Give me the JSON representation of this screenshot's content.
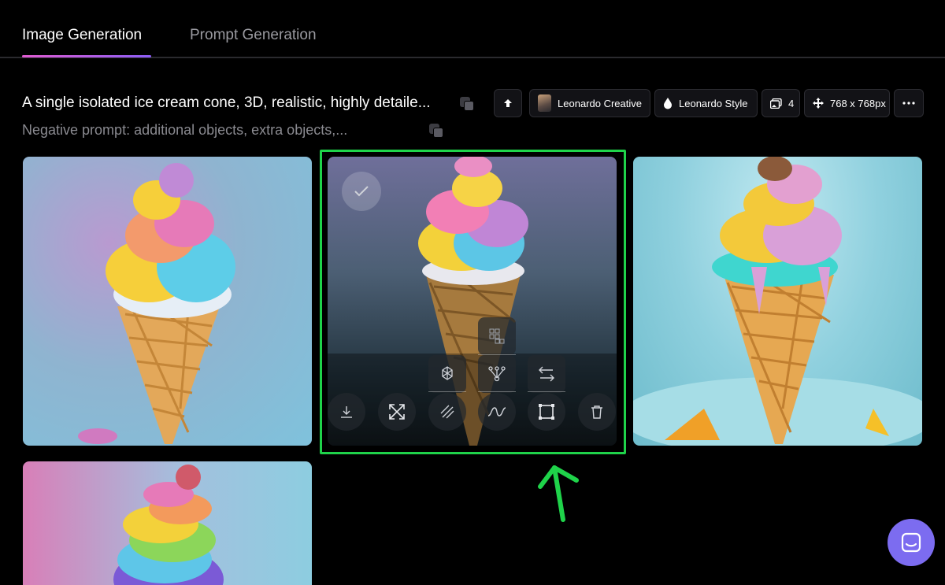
{
  "tabs": [
    {
      "label": "Image Generation",
      "active": true
    },
    {
      "label": "Prompt Generation",
      "active": false
    }
  ],
  "prompt": {
    "text": "A single isolated ice cream cone, 3D, realistic, highly detaile...",
    "negative": "Negative prompt: additional objects, extra objects,..."
  },
  "toolbar": {
    "model": "Leonardo Creative",
    "style": "Leonardo Style",
    "count": "4",
    "size": "768 x 768px"
  },
  "images": [
    {
      "name": "ice-cream-1",
      "selected": false
    },
    {
      "name": "ice-cream-2",
      "selected": true
    },
    {
      "name": "ice-cream-3",
      "selected": false
    },
    {
      "name": "ice-cream-4",
      "selected": false
    }
  ],
  "colors": {
    "accent_gradient_start": "#e05bd0",
    "accent_gradient_end": "#8b5cf6",
    "highlight": "#1fd34a",
    "chat_button": "#7c6cf0"
  },
  "icons": {
    "upload": "arrow-up-icon",
    "copy": "copy-icon",
    "more": "more-horizontal-icon",
    "download": "download-icon",
    "upscale": "expand-icon",
    "remove_bg": "remove-background-icon",
    "alchemy": "hexagon-icon",
    "canvas": "crop-frame-icon",
    "delete": "trash-icon",
    "chat": "chat-icon"
  }
}
